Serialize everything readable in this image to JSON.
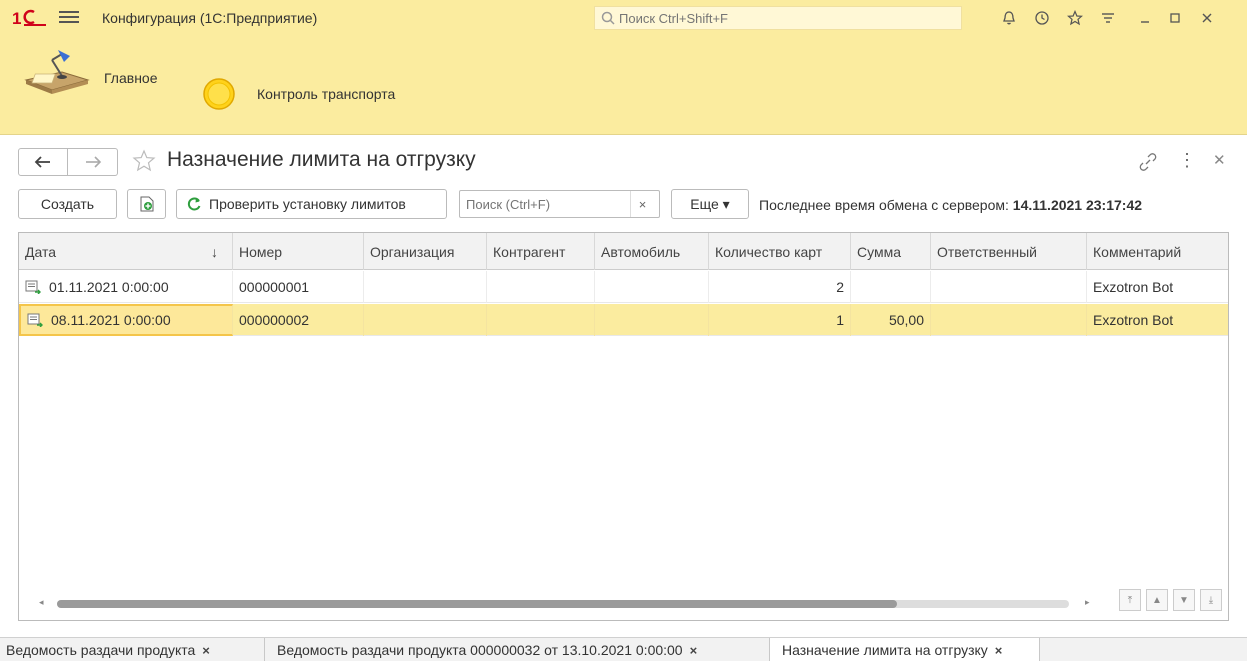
{
  "titlebar": {
    "app_title": "Конфигурация  (1С:Предприятие)",
    "search_placeholder": "Поиск Ctrl+Shift+F",
    "icons": [
      "bell-icon",
      "history-icon",
      "star-icon",
      "settings-menu-icon",
      "minimize-icon",
      "maximize-icon",
      "close-icon"
    ]
  },
  "sections": [
    {
      "label": "Главное",
      "icon": "desk-lamp-icon"
    },
    {
      "label": "Контроль транспорта",
      "icon": "yellow-circle-icon"
    }
  ],
  "form": {
    "title": "Назначение лимита на отгрузку"
  },
  "toolbar": {
    "create_label": "Создать",
    "check_limits_label": "Проверить установку лимитов",
    "search_placeholder": "Поиск (Ctrl+F)",
    "clear_label": "×",
    "more_label": "Еще ▾",
    "exchange_prefix": "Последнее время обмена с сервером:",
    "exchange_time": "14.11.2021 23:17:42"
  },
  "table": {
    "columns": [
      "Дата",
      "Номер",
      "Организация",
      "Контрагент",
      "Автомобиль",
      "Количество карт",
      "Сумма",
      "Ответственный",
      "Комментарий"
    ],
    "sort_indicator": "↓",
    "rows": [
      {
        "date": "01.11.2021 0:00:00",
        "number": "000000001",
        "organization": "",
        "counterparty": "",
        "car": "",
        "cards": "2",
        "sum": "",
        "responsible": "",
        "comment": "Exzotron Bot"
      },
      {
        "date": "08.11.2021 0:00:00",
        "number": "000000002",
        "organization": "",
        "counterparty": "",
        "car": "",
        "cards": "1",
        "sum": "50,00",
        "responsible": "",
        "comment": "Exzotron Bot"
      }
    ],
    "selected_row": 1
  },
  "open_windows": [
    {
      "label": "Ведомость раздачи продукта"
    },
    {
      "label": "Ведомость раздачи продукта 000000032 от 13.10.2021 0:00:00"
    },
    {
      "label": "Назначение лимита на отгрузку"
    }
  ],
  "colors": {
    "accent_yellow": "#fbec9f",
    "logo_red": "#d0021b",
    "refresh_green": "#2e9e3e"
  }
}
